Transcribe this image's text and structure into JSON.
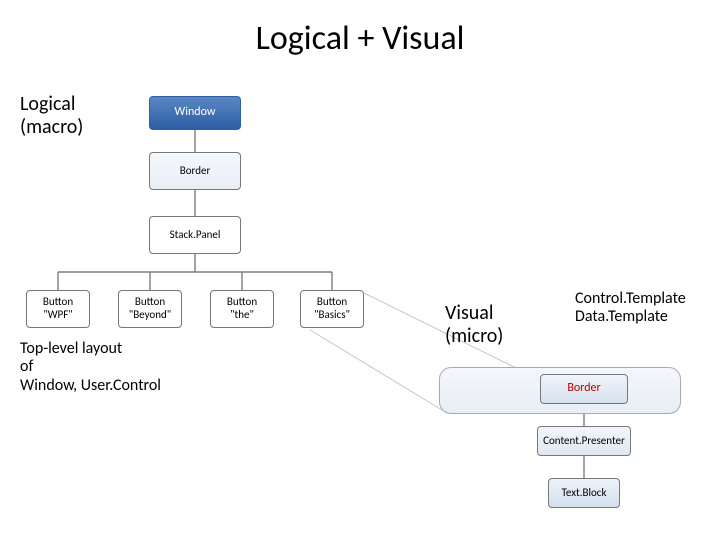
{
  "title": "Logical + Visual",
  "labels": {
    "logical_macro": "Logical\n(macro)",
    "top_layout": "Top-level layout\nof\nWindow, User.Control",
    "visual_micro": "Visual\n(micro)",
    "templates": "Control.Template\nData.Template"
  },
  "logical_tree": {
    "root": "Window",
    "child": "Border",
    "grandchild": "Stack.Panel",
    "buttons": [
      {
        "caption": "Button",
        "content": "\"WPF\""
      },
      {
        "caption": "Button",
        "content": "\"Beyond\""
      },
      {
        "caption": "Button",
        "content": "\"the\""
      },
      {
        "caption": "Button",
        "content": "\"Basics\""
      }
    ]
  },
  "visual_tree": {
    "border": "Border",
    "content_presenter": "Content.Presenter",
    "text_block": "Text.Block"
  }
}
